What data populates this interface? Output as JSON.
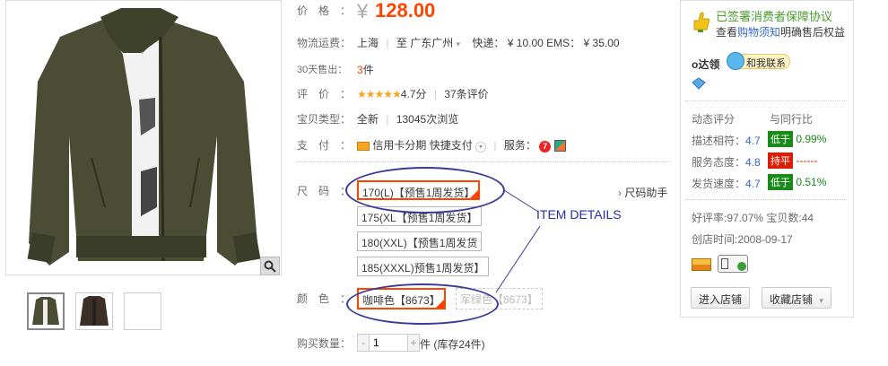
{
  "price": {
    "label": "价格：",
    "symbol": "¥",
    "value": "128.00"
  },
  "shipping": {
    "label": "物流运费：",
    "from": "上海",
    "to_prefix": "至",
    "to": "广东广州",
    "express_label": "快递：",
    "express_price": "¥ 10.00",
    "ems_label": "EMS：",
    "ems_price": "¥ 35.00"
  },
  "sales": {
    "label": "30天售出：",
    "count": "3",
    "unit": "件"
  },
  "rating": {
    "label": "评价：",
    "stars": "★★★★★",
    "score": "4.7分",
    "reviews": "37条评价"
  },
  "item_type": {
    "label": "宝贝类型：",
    "condition": "全新",
    "views": "13045次浏览"
  },
  "payment": {
    "label": "支付：",
    "installment": "信用卡分期",
    "quick_pay": "快捷支付",
    "service_label": "服务："
  },
  "size": {
    "label": "尺码：",
    "options": [
      "170(L)【预售1周发货】",
      "175(XL【预售1周发货】",
      "180(XXL)【预售1周发货",
      "185(XXXL)预售1周发货】"
    ],
    "helper": "尺码助手"
  },
  "color": {
    "label": "颜色：",
    "options": [
      "咖啡色【8673】",
      "军绿色【8673】"
    ]
  },
  "quantity": {
    "label": "购买数量：",
    "value": "1",
    "minus": "-",
    "plus": "+",
    "stock": "件 (库存24件)"
  },
  "annotation": {
    "text": "ITEM DETAILS"
  },
  "seller": {
    "promise_title": "已签署消费者保障协议",
    "promise_sub_pre": "查看",
    "promise_sub_link": "购物须知",
    "promise_sub_post": "明确售后权益",
    "name": "o达领",
    "contact": "和我联系",
    "dsr_title": "动态评分",
    "dsr_peer": "与同行比",
    "dsr": [
      {
        "label": "描述相符：",
        "score": "4.7",
        "badge": "低于",
        "pct": "0.99%",
        "kind": "low"
      },
      {
        "label": "服务态度：",
        "score": "4.8",
        "badge": "持平",
        "pct": "------",
        "kind": "flat"
      },
      {
        "label": "发货速度：",
        "score": "4.7",
        "badge": "低于",
        "pct": "0.51%",
        "kind": "low"
      }
    ],
    "good_rate": "好评率:97.07% 宝贝数:44",
    "open_time": "创店时间:2008-09-17",
    "enter_shop": "进入店铺",
    "fav_shop": "收藏店铺"
  },
  "colors": {
    "price": "#ff4400",
    "annotation": "#3b3a9b",
    "accent_green": "#1a8b1a"
  }
}
